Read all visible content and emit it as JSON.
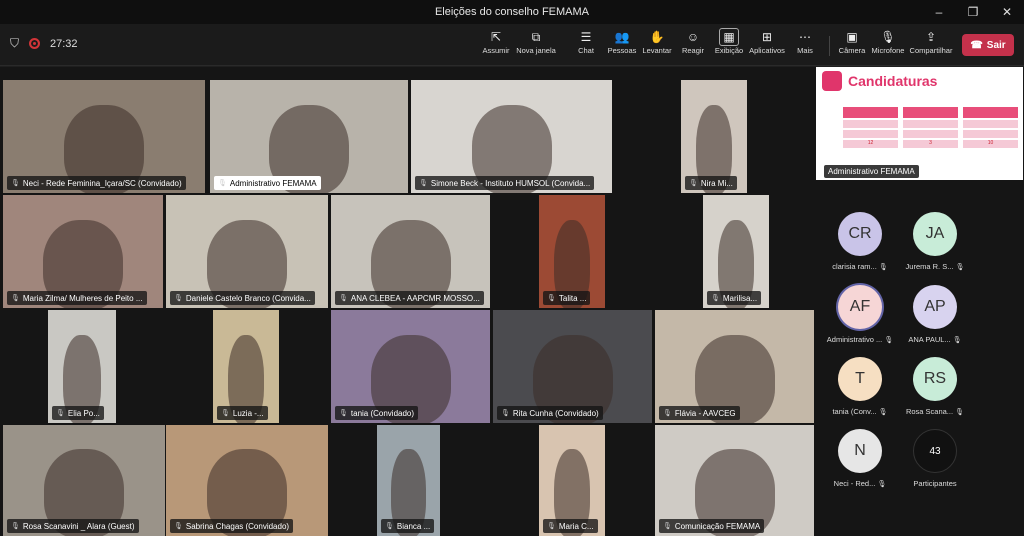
{
  "window": {
    "title": "Eleições do conselho FEMAMA",
    "controls": [
      "–",
      "❐",
      "✕"
    ]
  },
  "toolbar": {
    "timer": "27:32",
    "buttons": [
      {
        "label": "Assumir",
        "icon": "take-control-icon",
        "glyph": "⇱"
      },
      {
        "label": "Nova janela",
        "icon": "new-window-icon",
        "glyph": "⧉"
      },
      {
        "label": "Chat",
        "icon": "chat-icon",
        "glyph": "☰"
      },
      {
        "label": "Pessoas",
        "icon": "people-icon",
        "glyph": "👥"
      },
      {
        "label": "Levantar",
        "icon": "raise-hand-icon",
        "glyph": "✋"
      },
      {
        "label": "Reagir",
        "icon": "react-icon",
        "glyph": "☺"
      },
      {
        "label": "Exibição",
        "icon": "view-icon",
        "glyph": "▦"
      },
      {
        "label": "Aplicativos",
        "icon": "apps-icon",
        "glyph": "⊞"
      },
      {
        "label": "Mais",
        "icon": "more-icon",
        "glyph": "⋯"
      },
      {
        "label": "Câmera",
        "icon": "camera-icon",
        "glyph": "▣"
      },
      {
        "label": "Microfone",
        "icon": "microphone-off-icon",
        "glyph": "🎙"
      },
      {
        "label": "Compartilhar",
        "icon": "share-icon",
        "glyph": "⇪"
      }
    ],
    "leave": "Sair"
  },
  "tiles": [
    {
      "name": "Neci - Rede Feminina_Içara/SC (Convidado)",
      "color": "#8a7d70"
    },
    {
      "name": "Administrativo FEMAMA",
      "color": "#b8b3aa",
      "white": true
    },
    {
      "name": "Simone Beck - Instituto HUMSOL (Convida...",
      "color": "#d8d5d0"
    },
    {
      "name": "Nira Mi...",
      "color": "#cfc6bd"
    },
    {
      "name": "Maria Zilma/ Mulheres de Peito ...",
      "color": "#a0867c"
    },
    {
      "name": "Daniele Castelo Branco (Convida...",
      "color": "#c8c2b6"
    },
    {
      "name": "ANA CLEBEA - AAPCMR MOSSO...",
      "color": "#c7c3bb"
    },
    {
      "name": "Talita ...",
      "color": "#9c4a34"
    },
    {
      "name": "Marilisa...",
      "color": "#d6d2cb"
    },
    {
      "name": "Elia Po...",
      "color": "#c9c8c3"
    },
    {
      "name": "Luzia -...",
      "color": "#c9b996"
    },
    {
      "name": "tania (Convidado)",
      "color": "#8b7a9b"
    },
    {
      "name": "Rita Cunha (Convidado)",
      "color": "#4b4b4f"
    },
    {
      "name": "Flávia - AAVCEG",
      "color": "#c4b8a8"
    },
    {
      "name": "Rosa Scanavini _ Alara (Guest)",
      "color": "#9a9389"
    },
    {
      "name": "Sabrina Chagas (Convidado)",
      "color": "#b89878"
    },
    {
      "name": "Bianca ...",
      "color": "#9aa4aa"
    },
    {
      "name": "Maria C...",
      "color": "#d8c4b0"
    },
    {
      "name": "Comunicação FEMAMA",
      "color": "#cfcbc5"
    }
  ],
  "shared": {
    "title": "Candidaturas",
    "presenter": "Administrativo FEMAMA",
    "columns": [
      {
        "values": [
          "12"
        ]
      },
      {
        "values": [
          "3"
        ]
      },
      {
        "values": [
          "10"
        ]
      }
    ]
  },
  "roster": [
    {
      "initials": "CR",
      "label": "clarisia ram...",
      "color": "#c9c4e8"
    },
    {
      "initials": "JA",
      "label": "Jurema R. S...",
      "color": "#c8ecd8"
    },
    {
      "initials": "AF",
      "label": "Administrativo ...",
      "color": "#f6d6d6"
    },
    {
      "initials": "AP",
      "label": "ANA PAUL...",
      "color": "#d8d3ef"
    },
    {
      "initials": "T",
      "label": "tania (Conv...",
      "color": "#f6dfc2"
    },
    {
      "initials": "RS",
      "label": "Rosa Scana...",
      "color": "#c8ecd8"
    },
    {
      "initials": "N",
      "label": "Neci - Red...",
      "color": "#e6e6e6"
    },
    {
      "initials": "43",
      "label": "Participantes",
      "color": "#111111"
    }
  ]
}
